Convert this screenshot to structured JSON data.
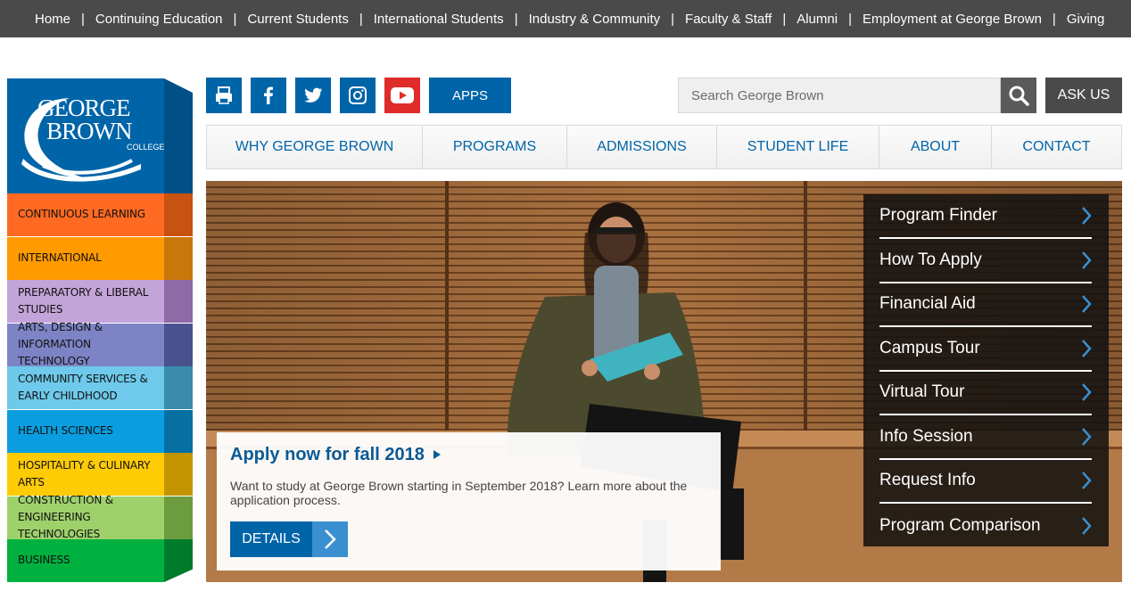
{
  "topnav": [
    "Home",
    "Continuing Education",
    "Current Students",
    "International Students",
    "Industry & Community",
    "Faculty & Staff",
    "Alumni",
    "Employment at George Brown",
    "Giving"
  ],
  "logo": {
    "line1": "GEORGE",
    "line2": "BROWN",
    "line3": "COLLEGE"
  },
  "categories": [
    {
      "label": "Continuous Learning",
      "color": "#ff6a22",
      "side": "#c85212"
    },
    {
      "label": "International",
      "color": "#ff9a00",
      "side": "#c8780a"
    },
    {
      "label": "Preparatory & Liberal Studies",
      "color": "#c3a4d8",
      "side": "#8e6aa6"
    },
    {
      "label": "Arts, Design & Information Technology",
      "color": "#7c84c5",
      "side": "#4a528e"
    },
    {
      "label": "Community Services & Early Childhood",
      "color": "#6ec9ea",
      "side": "#3a8cab"
    },
    {
      "label": "Health Sciences",
      "color": "#0a9ee0",
      "side": "#0670a3"
    },
    {
      "label": "Hospitality & Culinary Arts",
      "color": "#ffcb05",
      "side": "#c29500"
    },
    {
      "label": "Construction & Engineering Technologies",
      "color": "#9fd16b",
      "side": "#6c9c3d"
    },
    {
      "label": "Business",
      "color": "#00b140",
      "side": "#007a2b"
    }
  ],
  "social": [
    {
      "icon": "print-icon",
      "color": "#0064a8"
    },
    {
      "icon": "facebook-icon",
      "color": "#0064a8"
    },
    {
      "icon": "twitter-icon",
      "color": "#0064a8"
    },
    {
      "icon": "instagram-icon",
      "color": "#0064a8"
    },
    {
      "icon": "youtube-icon",
      "color": "#e02b2b"
    }
  ],
  "apps_label": "APPS",
  "search": {
    "placeholder": "Search George Brown"
  },
  "ask_label": "ASK US",
  "mainnav": [
    {
      "label": "WHY GEORGE BROWN",
      "width": 242
    },
    {
      "label": "PROGRAMS",
      "width": 162
    },
    {
      "label": "ADMISSIONS",
      "width": 168
    },
    {
      "label": "STUDENT LIFE",
      "width": 182
    },
    {
      "label": "ABOUT",
      "width": 126
    },
    {
      "label": "CONTACT",
      "width": 145
    }
  ],
  "quicklinks": [
    "Program Finder",
    "How To Apply",
    "Financial Aid",
    "Campus Tour",
    "Virtual Tour",
    "Info Session",
    "Request Info",
    "Program Comparison"
  ],
  "promo": {
    "title": "Apply now for fall 2018",
    "text": "Want to study at George Brown starting in September 2018? Learn more about the application process.",
    "button": "DETAILS"
  },
  "colors": {
    "brand": "#0064a8",
    "topbar": "#4a4a4a"
  }
}
